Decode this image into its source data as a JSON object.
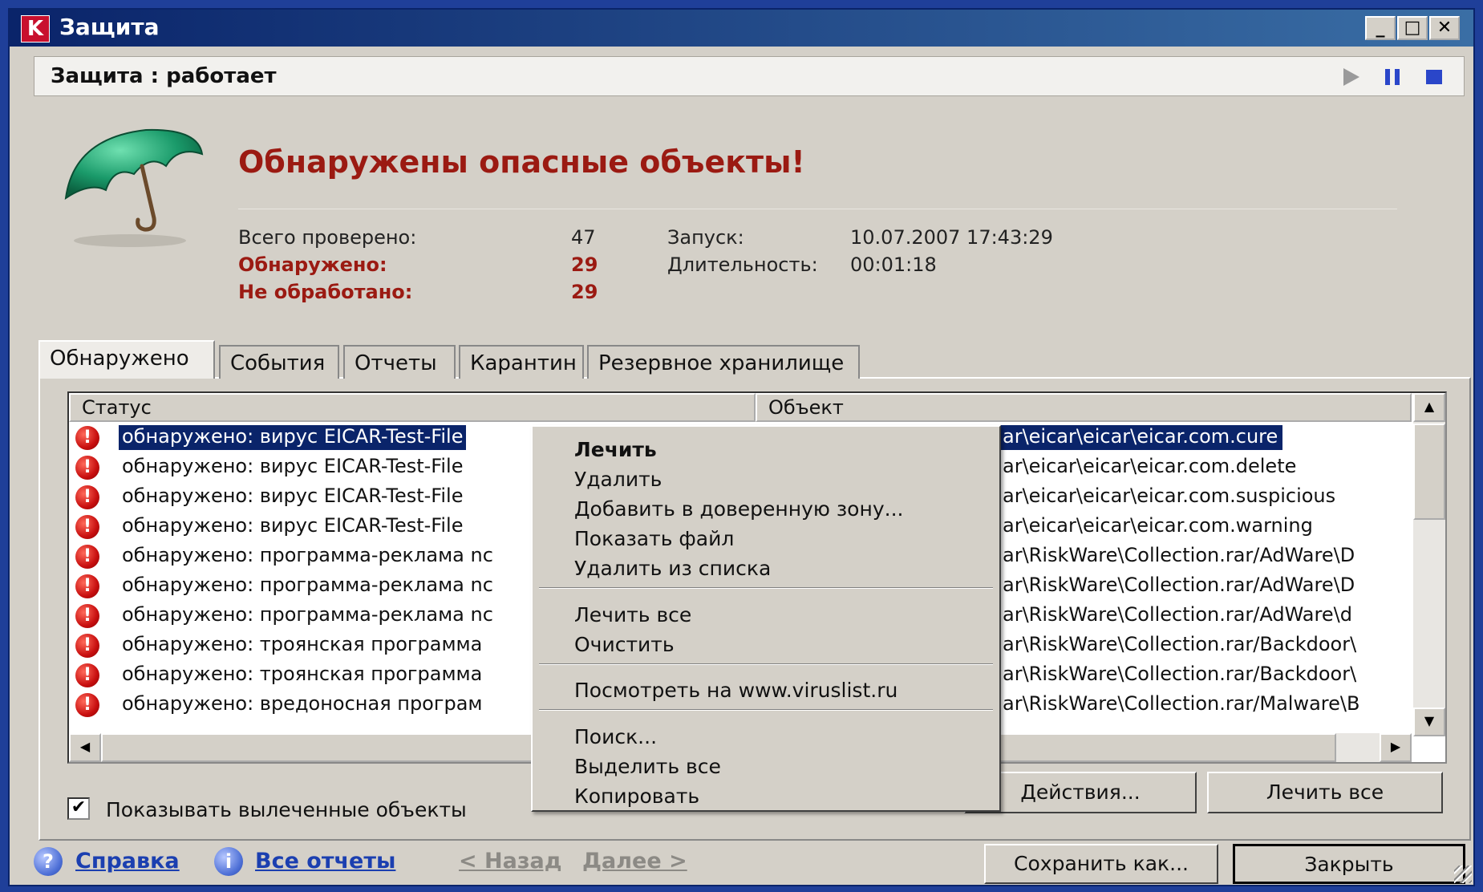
{
  "window": {
    "title": "Защита",
    "logo_letter": "K",
    "controls": {
      "minimize": "_",
      "maximize": "□",
      "close": "✕"
    }
  },
  "status": {
    "text": "Защита : работает"
  },
  "summary": {
    "headline": "Обнаружены опасные объекты!",
    "total_label": "Всего проверено:",
    "total_value": "47",
    "found_label": "Обнаружено:",
    "found_value": "29",
    "unprocessed_label": "Не обработано:",
    "unprocessed_value": "29",
    "start_label": "Запуск:",
    "start_value": "10.07.2007 17:43:29",
    "duration_label": "Длительность:",
    "duration_value": "00:01:18"
  },
  "tabs": [
    "Обнаружено",
    "События",
    "Отчеты",
    "Карантин",
    "Резервное хранилище"
  ],
  "table": {
    "columns": [
      "Статус",
      "Объект"
    ],
    "rows": [
      {
        "status": "обнаружено: вирус EICAR-Test-File",
        "object": "ar\\eicar\\eicar\\eicar.com.cure",
        "selected": true
      },
      {
        "status": "обнаружено: вирус EICAR-Test-File",
        "object": "ar\\eicar\\eicar\\eicar.com.delete"
      },
      {
        "status": "обнаружено: вирус EICAR-Test-File",
        "object": "ar\\eicar\\eicar\\eicar.com.suspicious"
      },
      {
        "status": "обнаружено: вирус EICAR-Test-File",
        "object": "ar\\eicar\\eicar\\eicar.com.warning"
      },
      {
        "status": "обнаружено: программа-реклама nc",
        "object": "ar\\RiskWare\\Collection.rar/AdWare\\D"
      },
      {
        "status": "обнаружено: программа-реклама nc",
        "object": "ar\\RiskWare\\Collection.rar/AdWare\\D"
      },
      {
        "status": "обнаружено: программа-реклама nc",
        "object": "ar\\RiskWare\\Collection.rar/AdWare\\d"
      },
      {
        "status": "обнаружено: троянская программа",
        "object": "ar\\RiskWare\\Collection.rar/Backdoor\\"
      },
      {
        "status": "обнаружено: троянская программа",
        "object": "ar\\RiskWare\\Collection.rar/Backdoor\\"
      },
      {
        "status": "обнаружено: вредоносная програм",
        "object": "ar\\RiskWare\\Collection.rar/Malware\\B"
      }
    ]
  },
  "context_menu": [
    {
      "label": "Лечить",
      "bold": true
    },
    {
      "label": "Удалить"
    },
    {
      "label": "Добавить в доверенную зону..."
    },
    {
      "label": "Показать файл"
    },
    {
      "label": "Удалить из списка"
    },
    {
      "label": "Лечить все"
    },
    {
      "label": "Очистить"
    },
    {
      "label": "Посмотреть на www.viruslist.ru"
    },
    {
      "label": "Поиск..."
    },
    {
      "label": "Выделить все"
    },
    {
      "label": "Копировать"
    }
  ],
  "options": {
    "show_cured_label": "Показывать вылеченные объекты",
    "show_cured_checked": true
  },
  "buttons": {
    "actions": "Действия...",
    "cure_all": "Лечить все",
    "save_as": "Сохранить как...",
    "close": "Закрыть"
  },
  "footer": {
    "help": "Справка",
    "all_reports": "Все отчеты",
    "back": "< Назад",
    "next": "Далее >"
  },
  "colors": {
    "accent_red": "#9b1a12",
    "selection": "#0a246a",
    "link": "#1b3fb0",
    "titlebar": "#0a246a"
  }
}
